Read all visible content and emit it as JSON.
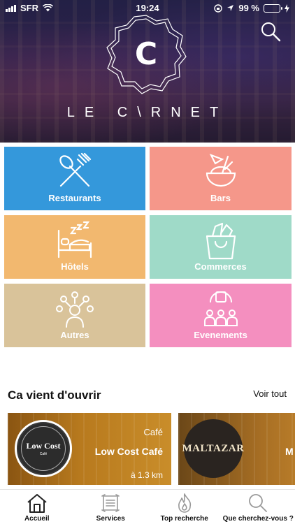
{
  "status_bar": {
    "carrier": "SFR",
    "time": "19:24",
    "battery": "99 %",
    "battery_color": "#34c759"
  },
  "header": {
    "logo_letter": "C",
    "logo_text": "LE C\\RNET",
    "search_icon": "search-icon"
  },
  "categories": [
    {
      "label": "Restaurants",
      "color": "#3498db",
      "icon": "fork-spoon-icon"
    },
    {
      "label": "Bars",
      "color": "#f5978a",
      "icon": "coconut-cocktail-icon"
    },
    {
      "label": "Hôtels",
      "color": "#f2b86f",
      "icon": "bed-sleep-icon"
    },
    {
      "label": "Commerces",
      "color": "#9fdac8",
      "icon": "shopping-bag-icon"
    },
    {
      "label": "Autres",
      "color": "#d9c39a",
      "icon": "person-ideas-icon"
    },
    {
      "label": "Evenements",
      "color": "#f48fbf",
      "icon": "audience-icon"
    }
  ],
  "section": {
    "title": "Ca vient d'ouvrir",
    "see_all": "Voir tout"
  },
  "cards": [
    {
      "category": "Café",
      "name": "Low Cost Café",
      "distance": "à 1.3 km",
      "logo_name": "Low Cost",
      "logo_sub": "Café"
    },
    {
      "logo_name": "MALTAZAR",
      "name_partial": "M"
    }
  ],
  "tabs": [
    {
      "label": "Accueil",
      "icon": "home-icon"
    },
    {
      "label": "Services",
      "icon": "services-icon"
    },
    {
      "label": "Top recherche",
      "icon": "flame-icon"
    },
    {
      "label": "Que cherchez-vous ?",
      "icon": "search-icon"
    }
  ]
}
